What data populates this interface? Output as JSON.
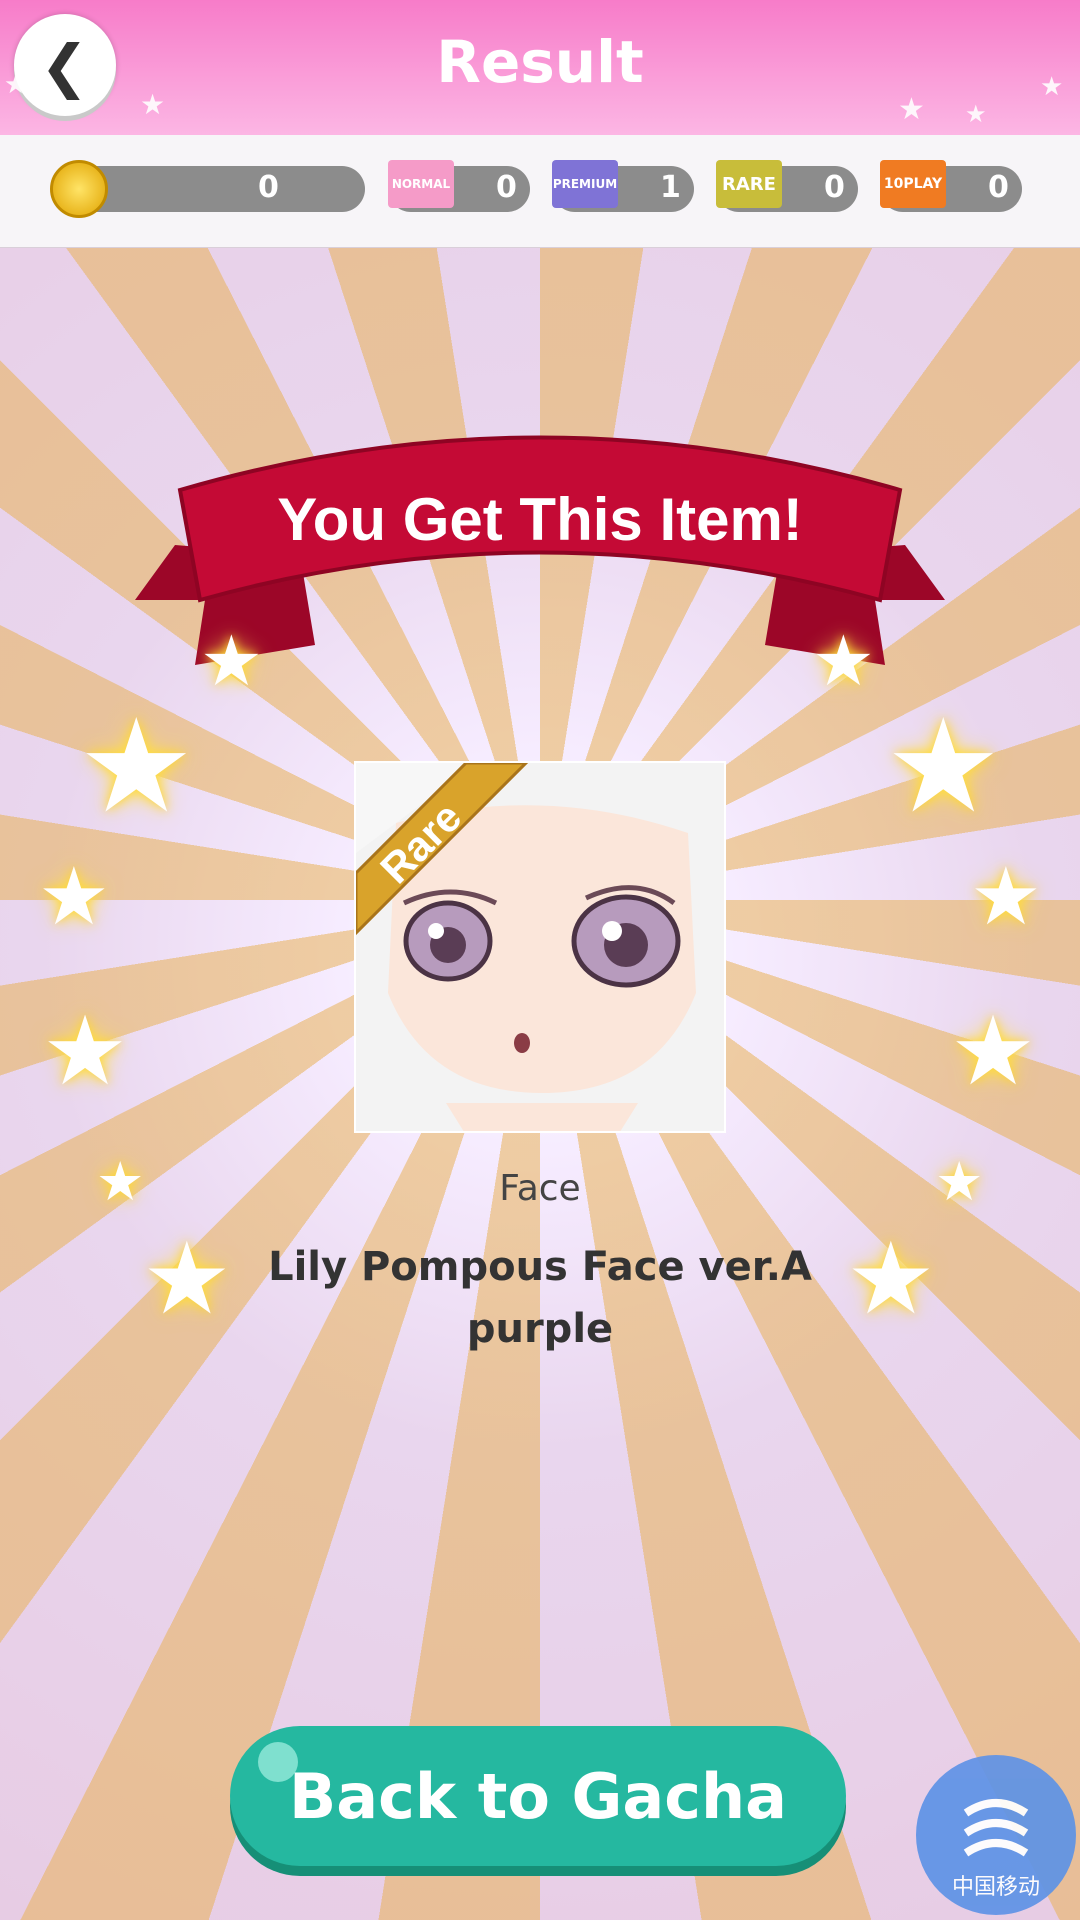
{
  "header": {
    "title": "Result",
    "back_icon": "chevron-left-icon"
  },
  "currencies": {
    "coin": {
      "icon": "gold-coin-icon",
      "count": "0"
    },
    "tickets": [
      {
        "label": "NORMAL",
        "count": "0",
        "color": "#f59bc8"
      },
      {
        "label": "PREMIUM",
        "count": "1",
        "color": "#7f73d6"
      },
      {
        "label": "RARE",
        "count": "0",
        "color": "#c8bd3a"
      },
      {
        "label": "10PLAY",
        "count": "0",
        "color": "#f07b22"
      }
    ]
  },
  "banner": {
    "text": "You Get This Item!",
    "color": "#c40a35"
  },
  "item": {
    "rarity": "Rare",
    "category": "Face",
    "name": "Lily Pompous Face ver.A purple"
  },
  "cta": {
    "label": "Back to Gacha",
    "color": "#25b8a0"
  },
  "carrier_badge": {
    "label": "中国移动"
  }
}
